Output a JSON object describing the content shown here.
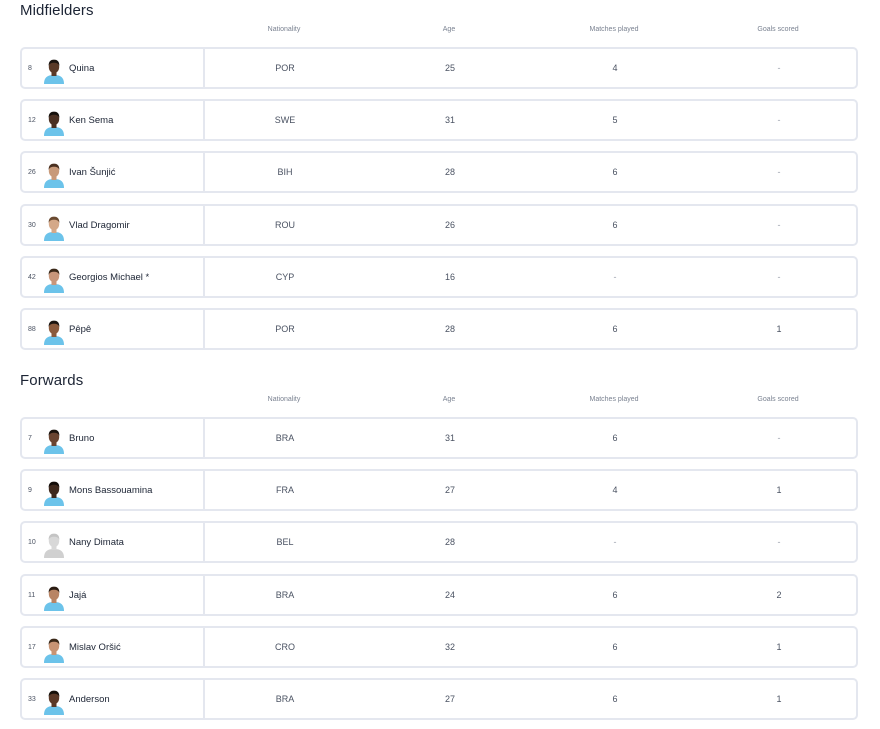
{
  "columns": {
    "nationality": "Nationality",
    "age": "Age",
    "matches": "Matches played",
    "goals": "Goals scored"
  },
  "sections": [
    {
      "title": "Midfielders",
      "players": [
        {
          "number": "8",
          "name": "Quina",
          "nationality": "POR",
          "age": "25",
          "matches": "4",
          "goals": "-",
          "skin": "#5a3a28",
          "hair": "#1a1410"
        },
        {
          "number": "12",
          "name": "Ken Sema",
          "nationality": "SWE",
          "age": "31",
          "matches": "5",
          "goals": "-",
          "skin": "#4a3022",
          "hair": "#15100c"
        },
        {
          "number": "26",
          "name": "Ivan Šunjić",
          "nationality": "BIH",
          "age": "28",
          "matches": "6",
          "goals": "-",
          "skin": "#c89a7a",
          "hair": "#4a3020"
        },
        {
          "number": "30",
          "name": "Vlad Dragomir",
          "nationality": "ROU",
          "age": "26",
          "matches": "6",
          "goals": "-",
          "skin": "#d4a888",
          "hair": "#6a4a30"
        },
        {
          "number": "42",
          "name": "Georgios Michael *",
          "nationality": "CYP",
          "age": "16",
          "matches": "-",
          "goals": "-",
          "skin": "#c8967a",
          "hair": "#3a2818"
        },
        {
          "number": "88",
          "name": "Pêpê",
          "nationality": "POR",
          "age": "28",
          "matches": "6",
          "goals": "1",
          "skin": "#8a5a3c",
          "hair": "#1a1410"
        }
      ]
    },
    {
      "title": "Forwards",
      "players": [
        {
          "number": "7",
          "name": "Bruno",
          "nationality": "BRA",
          "age": "31",
          "matches": "6",
          "goals": "-",
          "skin": "#6a4430",
          "hair": "#1a120c"
        },
        {
          "number": "9",
          "name": "Mons Bassouamina",
          "nationality": "FRA",
          "age": "27",
          "matches": "4",
          "goals": "1",
          "skin": "#3e281c",
          "hair": "#120c08"
        },
        {
          "number": "10",
          "name": "Nany Dimata",
          "nationality": "BEL",
          "age": "28",
          "matches": "-",
          "goals": "-",
          "skin": "#d8d8d8",
          "hair": "#c4c4c4",
          "placeholder": true
        },
        {
          "number": "11",
          "name": "Jajá",
          "nationality": "BRA",
          "age": "24",
          "matches": "6",
          "goals": "2",
          "skin": "#b88464",
          "hair": "#2a1c12"
        },
        {
          "number": "17",
          "name": "Mislav Oršić",
          "nationality": "CRO",
          "age": "32",
          "matches": "6",
          "goals": "1",
          "skin": "#c89474",
          "hair": "#3a2818"
        },
        {
          "number": "33",
          "name": "Anderson",
          "nationality": "BRA",
          "age": "27",
          "matches": "6",
          "goals": "1",
          "skin": "#5a3826",
          "hair": "#16100a"
        }
      ]
    }
  ],
  "colors": {
    "jersey": "#6cc3ea",
    "border": "#e4e7ef",
    "text": "#1c2434",
    "muted": "#7a8291"
  }
}
